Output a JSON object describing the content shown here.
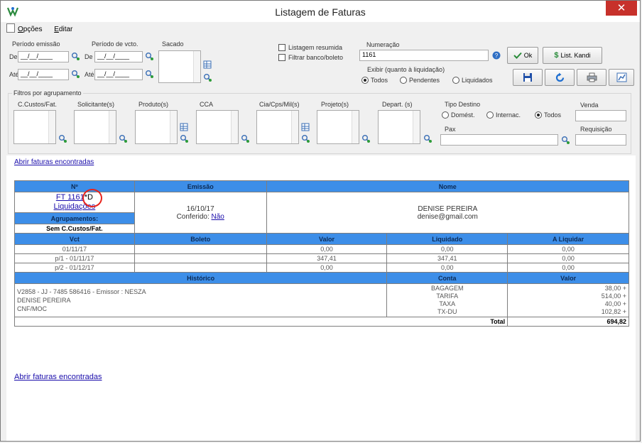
{
  "window": {
    "title": "Listagem de Faturas",
    "close_glyph": "✕"
  },
  "menu": {
    "opcoes": "Opções",
    "editar": "Editar"
  },
  "filters": {
    "periodo_emissao": "Período emissão",
    "periodo_vcto": "Período de vcto.",
    "sacado": "Sacado",
    "de": "De",
    "ate": "Até",
    "date_placeholder": "__/__/____",
    "listagem_resumida": "Listagem resumida",
    "filtrar_banco": "Filtrar banco/boleto",
    "numeracao": "Numeração",
    "numeracao_value": "1161",
    "ok": "Ok",
    "list_kandi": "List. Kandi",
    "exibir_label": "Exibir (quanto à liquidação)",
    "exibir_options": [
      "Todos",
      "Pendentes",
      "Liquidados"
    ],
    "filtros_agrupamento": "Filtros por agrupamento",
    "agrupamentos": [
      "C.Custos/Fat.",
      "Solicitante(s)",
      "Produto(s)",
      "CCA",
      "Cia/Cps/Mil(s)",
      "Projeto(s)",
      "Depart. (s)"
    ],
    "tipo_destino": "Tipo Destino",
    "tipo_destino_options": [
      "Domést.",
      "Internac.",
      "Todos"
    ],
    "venda": "Venda",
    "pax": "Pax",
    "requisicao": "Requisição"
  },
  "links": {
    "abrir_faturas": "Abrir faturas encontradas"
  },
  "invoice": {
    "headers": {
      "numero": "Nº",
      "emissao": "Emissão",
      "nome": "Nome"
    },
    "ft": "FT 1161",
    "suffix": "*D",
    "liquidacoes": "Liquidações",
    "agrupamentos_label": "Agrupamentos:",
    "agrupamentos_value": "Sem C.Custos/Fat.",
    "emissao_date": "16/10/17",
    "conferido_label": "Conferido:",
    "conferido_value": "Não",
    "nome": "DENISE PEREIRA",
    "email": "denise@gmail.com",
    "parcel_headers": [
      "Vct",
      "Boleto",
      "Valor",
      "Liquidado",
      "A Liquidar"
    ],
    "parcels": [
      {
        "vct": "01/11/17",
        "boleto": "",
        "valor": "0,00",
        "liquidado": "0,00",
        "aliquidar": "0,00"
      },
      {
        "vct": "p/1 - 01/11/17",
        "boleto": "",
        "valor": "347,41",
        "liquidado": "347,41",
        "aliquidar": "0,00"
      },
      {
        "vct": "p/2 - 01/12/17",
        "boleto": "",
        "valor": "0,00",
        "liquidado": "0,00",
        "aliquidar": "0,00"
      }
    ],
    "hist_headers": [
      "Histórico",
      "Conta",
      "Valor"
    ],
    "historico": [
      "V2858 - JJ - 7485 586416 - Emissor : NESZA",
      "DENISE PEREIRA",
      "CNF/MOC"
    ],
    "contas": [
      "BAGAGEM",
      "TARIFA",
      "TAXA",
      "TX-DU"
    ],
    "valores": [
      "38,00 +",
      "514,00 +",
      "40,00 +",
      "102,82 +"
    ],
    "total_label": "Total",
    "total_value": "694,82"
  },
  "colors": {
    "header_blue": "#3d8ee8",
    "close_red": "#c7312b",
    "annotation_red": "#e8231b"
  }
}
